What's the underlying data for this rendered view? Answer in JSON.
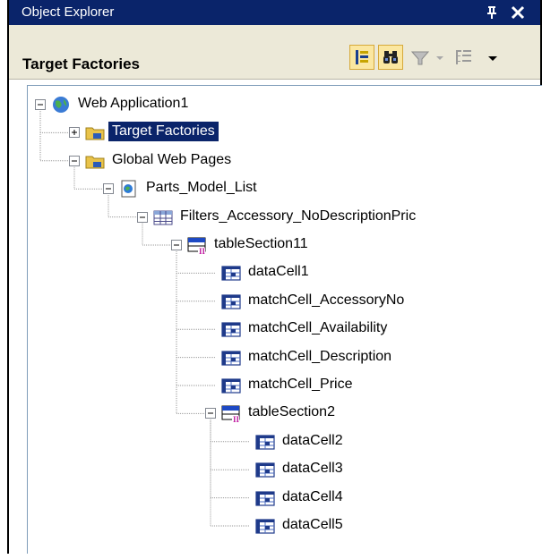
{
  "panel": {
    "title": "Object Explorer",
    "pin_icon": "pin-icon",
    "pin_glyph": "⬇",
    "close_glyph": "✕",
    "close_icon": "close-icon"
  },
  "toolbar": {
    "title": "Target Factories",
    "buttons": [
      {
        "name": "toggle-tree-icon"
      },
      {
        "name": "binoculars-icon"
      },
      {
        "name": "filter-icon"
      },
      {
        "name": "dropdown-arrow-icon"
      },
      {
        "name": "tree-structure-icon"
      },
      {
        "name": "chevron-down-icon"
      }
    ]
  },
  "colors": {
    "titlebar": "#0a246a",
    "toolbar_bg": "#ece9d8",
    "selected_bg": "#0a246a",
    "selected_fg": "#ffffff"
  },
  "tree": {
    "nodes": [
      {
        "label": "Web Application1",
        "icon": "globe-icon",
        "depth": 0,
        "expander": "-",
        "selected": false
      },
      {
        "label": "Target Factories",
        "icon": "folder-icon",
        "depth": 1,
        "expander": "+",
        "selected": true
      },
      {
        "label": "Global Web Pages",
        "icon": "folder-icon",
        "depth": 1,
        "expander": "-",
        "selected": false
      },
      {
        "label": "Parts_Model_List",
        "icon": "web-page-icon",
        "depth": 2,
        "expander": "-",
        "selected": false
      },
      {
        "label": "Filters_Accessory_NoDescriptionPric",
        "icon": "table-icon",
        "depth": 3,
        "expander": "-",
        "selected": false
      },
      {
        "label": "tableSection11",
        "icon": "table-section-icon",
        "depth": 4,
        "expander": "-",
        "selected": false
      },
      {
        "label": "dataCell1",
        "icon": "data-cell-icon",
        "depth": 5,
        "expander": "",
        "selected": false
      },
      {
        "label": "matchCell_AccessoryNo",
        "icon": "data-cell-icon",
        "depth": 5,
        "expander": "",
        "selected": false
      },
      {
        "label": "matchCell_Availability",
        "icon": "data-cell-icon",
        "depth": 5,
        "expander": "",
        "selected": false
      },
      {
        "label": "matchCell_Description",
        "icon": "data-cell-icon",
        "depth": 5,
        "expander": "",
        "selected": false
      },
      {
        "label": "matchCell_Price",
        "icon": "data-cell-icon",
        "depth": 5,
        "expander": "",
        "selected": false
      },
      {
        "label": "tableSection2",
        "icon": "table-section-icon",
        "depth": 5,
        "expander": "-",
        "selected": false
      },
      {
        "label": "dataCell2",
        "icon": "data-cell-icon",
        "depth": 6,
        "expander": "",
        "selected": false
      },
      {
        "label": "dataCell3",
        "icon": "data-cell-icon",
        "depth": 6,
        "expander": "",
        "selected": false
      },
      {
        "label": "dataCell4",
        "icon": "data-cell-icon",
        "depth": 6,
        "expander": "",
        "selected": false
      },
      {
        "label": "dataCell5",
        "icon": "data-cell-icon",
        "depth": 6,
        "expander": "",
        "selected": false
      }
    ]
  }
}
